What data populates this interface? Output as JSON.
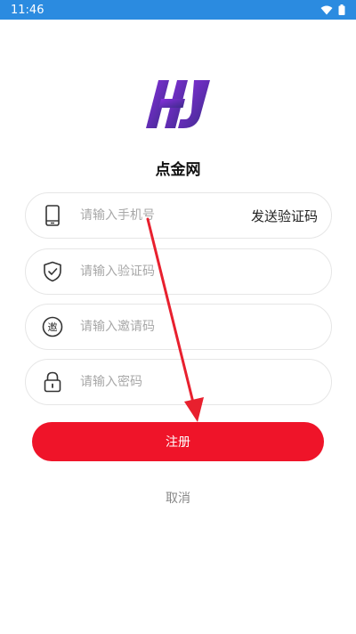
{
  "status_bar": {
    "time": "11:46"
  },
  "app": {
    "name": "点金网"
  },
  "form": {
    "phone_placeholder": "请输入手机号",
    "send_code_label": "发送验证码",
    "code_placeholder": "请输入验证码",
    "invite_placeholder": "请输入邀请码",
    "invite_icon_char": "邀",
    "password_placeholder": "请输入密码"
  },
  "actions": {
    "register_label": "注册",
    "cancel_label": "取消"
  },
  "colors": {
    "status_bar": "#2b8be0",
    "primary": "#ef1429",
    "logo_gradient_start": "#7a2bd6",
    "logo_gradient_end": "#3b2a8a"
  }
}
